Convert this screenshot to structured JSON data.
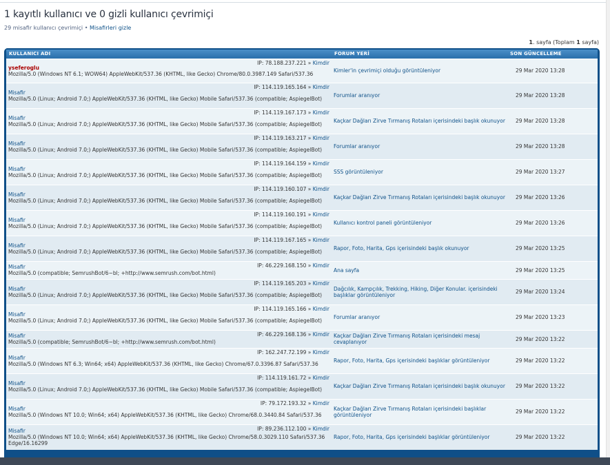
{
  "header": {
    "title": "1 kayıtlı kullanıcı ve 0 gizli kullanıcı çevrimiçi",
    "subtitle_text": "29 misafir kullanıcı çevrimiçi",
    "separator": " • ",
    "hide_guests_link": "Misafirleri gizle"
  },
  "pagination": {
    "page_num": "1",
    "page_label": ". sayfa (Toplam ",
    "total_num": "1",
    "total_label": " sayfa)"
  },
  "table": {
    "columns": {
      "user": "KULLANICI ADI",
      "location": "FORUM YERİ",
      "last_update": "SON GÜNCELLEME"
    },
    "rows": [
      {
        "name": "yseferoglu",
        "ip": "IP: 78.188.237.221",
        "whois": "Kimdir",
        "ua": "Mozilla/5.0 (Windows NT 6.1; WOW64) AppleWebKit/537.36 (KHTML, like Gecko) Chrome/80.0.3987.149 Safari/537.36",
        "location": "Kimler'in çevrimiçi olduğu görüntüleniyor",
        "time": "29 Mar 2020 13:28"
      },
      {
        "name": "Misafir",
        "ip": "IP: 114.119.165.164",
        "whois": "Kimdir",
        "ua": "Mozilla/5.0 (Linux; Android 7.0;) AppleWebKit/537.36 (KHTML, like Gecko) Mobile Safari/537.36 (compatible; AspiegelBot)",
        "location": "Forumlar aranıyor",
        "time": "29 Mar 2020 13:28"
      },
      {
        "name": "Misafir",
        "ip": "IP: 114.119.167.173",
        "whois": "Kimdir",
        "ua": "Mozilla/5.0 (Linux; Android 7.0;) AppleWebKit/537.36 (KHTML, like Gecko) Mobile Safari/537.36 (compatible; AspiegelBot)",
        "location": "Kaçkar Dağları Zirve Tırmanış Rotaları içerisindeki başlık okunuyor",
        "time": "29 Mar 2020 13:28"
      },
      {
        "name": "Misafir",
        "ip": "IP: 114.119.163.217",
        "whois": "Kimdir",
        "ua": "Mozilla/5.0 (Linux; Android 7.0;) AppleWebKit/537.36 (KHTML, like Gecko) Mobile Safari/537.36 (compatible; AspiegelBot)",
        "location": "Forumlar aranıyor",
        "time": "29 Mar 2020 13:28"
      },
      {
        "name": "Misafir",
        "ip": "IP: 114.119.164.159",
        "whois": "Kimdir",
        "ua": "Mozilla/5.0 (Linux; Android 7.0;) AppleWebKit/537.36 (KHTML, like Gecko) Mobile Safari/537.36 (compatible; AspiegelBot)",
        "location": "SSS görüntüleniyor",
        "time": "29 Mar 2020 13:27"
      },
      {
        "name": "Misafir",
        "ip": "IP: 114.119.160.107",
        "whois": "Kimdir",
        "ua": "Mozilla/5.0 (Linux; Android 7.0;) AppleWebKit/537.36 (KHTML, like Gecko) Mobile Safari/537.36 (compatible; AspiegelBot)",
        "location": "Kaçkar Dağları Zirve Tırmanış Rotaları içerisindeki başlık okunuyor",
        "time": "29 Mar 2020 13:26"
      },
      {
        "name": "Misafir",
        "ip": "IP: 114.119.160.191",
        "whois": "Kimdir",
        "ua": "Mozilla/5.0 (Linux; Android 7.0;) AppleWebKit/537.36 (KHTML, like Gecko) Mobile Safari/537.36 (compatible; AspiegelBot)",
        "location": "Kullanıcı kontrol paneli görüntüleniyor",
        "time": "29 Mar 2020 13:26"
      },
      {
        "name": "Misafir",
        "ip": "IP: 114.119.167.165",
        "whois": "Kimdir",
        "ua": "Mozilla/5.0 (Linux; Android 7.0;) AppleWebKit/537.36 (KHTML, like Gecko) Mobile Safari/537.36 (compatible; AspiegelBot)",
        "location": "Rapor, Foto, Harita, Gps içerisindeki başlık okunuyor",
        "time": "29 Mar 2020 13:25"
      },
      {
        "name": "Misafir",
        "ip": "IP: 46.229.168.150",
        "whois": "Kimdir",
        "ua": "Mozilla/5.0 (compatible; SemrushBot/6~bl; +http://www.semrush.com/bot.html)",
        "location": "Ana sayfa",
        "time": "29 Mar 2020 13:25"
      },
      {
        "name": "Misafir",
        "ip": "IP: 114.119.165.203",
        "whois": "Kimdir",
        "ua": "Mozilla/5.0 (Linux; Android 7.0;) AppleWebKit/537.36 (KHTML, like Gecko) Mobile Safari/537.36 (compatible; AspiegelBot)",
        "location": "Dağcılık, Kampçılık, Trekking, Hiking, Diğer Konular. içerisindeki başlıklar görüntüleniyor",
        "time": "29 Mar 2020 13:24"
      },
      {
        "name": "Misafir",
        "ip": "IP: 114.119.165.166",
        "whois": "Kimdir",
        "ua": "Mozilla/5.0 (Linux; Android 7.0;) AppleWebKit/537.36 (KHTML, like Gecko) Mobile Safari/537.36 (compatible; AspiegelBot)",
        "location": "Forumlar aranıyor",
        "time": "29 Mar 2020 13:23"
      },
      {
        "name": "Misafir",
        "ip": "IP: 46.229.168.136",
        "whois": "Kimdir",
        "ua": "Mozilla/5.0 (compatible; SemrushBot/6~bl; +http://www.semrush.com/bot.html)",
        "location": "Kaçkar Dağları Zirve Tırmanış Rotaları içerisindeki mesaj cevaplanıyor",
        "time": "29 Mar 2020 13:22"
      },
      {
        "name": "Misafir",
        "ip": "IP: 162.247.72.199",
        "whois": "Kimdir",
        "ua": "Mozilla/5.0 (Windows NT 6.3; Win64; x64) AppleWebKit/537.36 (KHTML, like Gecko) Chrome/67.0.3396.87 Safari/537.36",
        "location": "Rapor, Foto, Harita, Gps içerisindeki başlıklar görüntüleniyor",
        "time": "29 Mar 2020 13:22"
      },
      {
        "name": "Misafir",
        "ip": "IP: 114.119.161.72",
        "whois": "Kimdir",
        "ua": "Mozilla/5.0 (Linux; Android 7.0;) AppleWebKit/537.36 (KHTML, like Gecko) Mobile Safari/537.36 (compatible; AspiegelBot)",
        "location": "Kaçkar Dağları Zirve Tırmanış Rotaları içerisindeki başlık okunuyor",
        "time": "29 Mar 2020 13:22"
      },
      {
        "name": "Misafir",
        "ip": "IP: 79.172.193.32",
        "whois": "Kimdir",
        "ua": "Mozilla/5.0 (Windows NT 10.0; Win64; x64) AppleWebKit/537.36 (KHTML, like Gecko) Chrome/68.0.3440.84 Safari/537.36",
        "location": "Kaçkar Dağları Zirve Tırmanış Rotaları içerisindeki başlıklar görüntüleniyor",
        "time": "29 Mar 2020 13:22"
      },
      {
        "name": "Misafir",
        "ip": "IP: 89.236.112.100",
        "whois": "Kimdir",
        "ua": "Mozilla/5.0 (Windows NT 10.0; Win64; x64) AppleWebKit/537.36 (KHTML, like Gecko) Chrome/58.0.3029.110 Safari/537.36 Edge/16.16299",
        "location": "Rapor, Foto, Harita, Gps içerisindeki başlıklar görüntüleniyor",
        "time": "29 Mar 2020 13:22"
      }
    ]
  }
}
